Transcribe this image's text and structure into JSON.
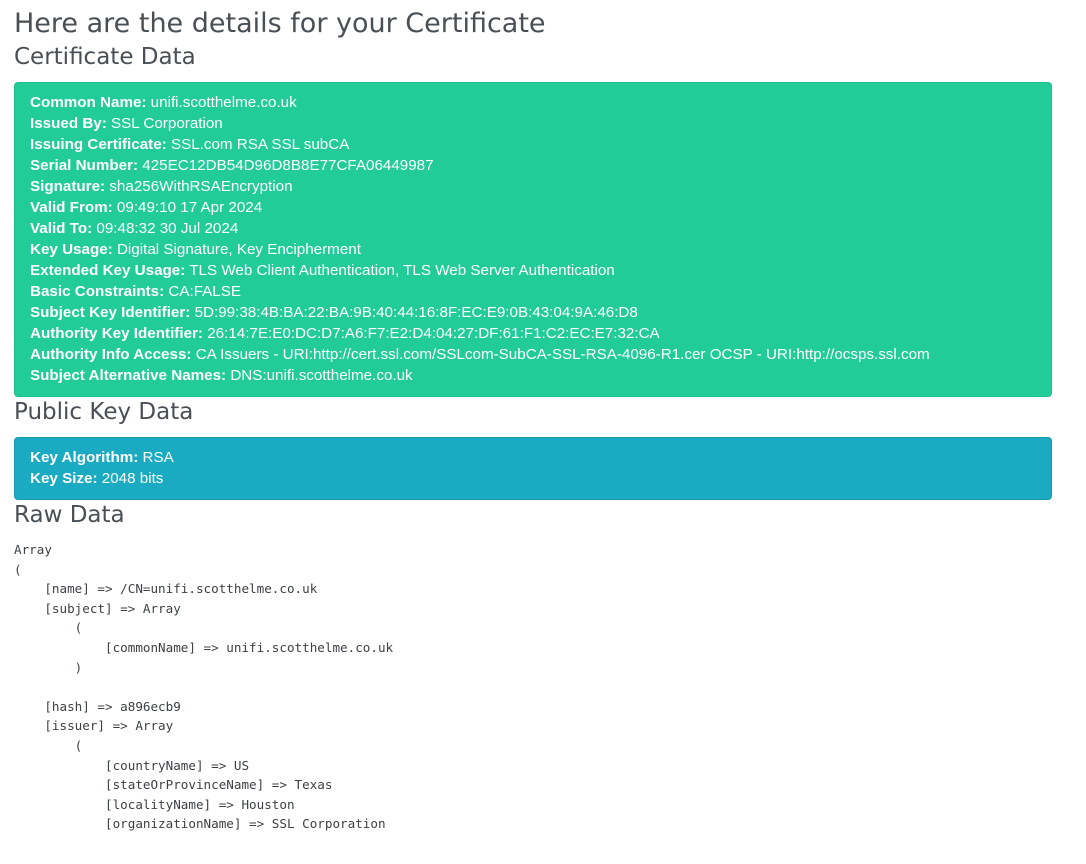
{
  "page": {
    "title": "Here are the details for your Certificate"
  },
  "certificate": {
    "heading": "Certificate Data",
    "fields": [
      {
        "label": "Common Name:",
        "value": " unifi.scotthelme.co.uk"
      },
      {
        "label": "Issued By:",
        "value": " SSL Corporation"
      },
      {
        "label": "Issuing Certificate:",
        "value": " SSL.com RSA SSL subCA"
      },
      {
        "label": "Serial Number:",
        "value": " 425EC12DB54D96D8B8E77CFA06449987"
      },
      {
        "label": "Signature:",
        "value": " sha256WithRSAEncryption"
      },
      {
        "label": "Valid From:",
        "value": " 09:49:10 17 Apr 2024"
      },
      {
        "label": "Valid To:",
        "value": " 09:48:32 30 Jul 2024"
      },
      {
        "label": "Key Usage:",
        "value": " Digital Signature, Key Encipherment"
      },
      {
        "label": "Extended Key Usage:",
        "value": " TLS Web Client Authentication, TLS Web Server Authentication"
      },
      {
        "label": "Basic Constraints:",
        "value": " CA:FALSE"
      },
      {
        "label": "Subject Key Identifier:",
        "value": " 5D:99:38:4B:BA:22:BA:9B:40:44:16:8F:EC:E9:0B:43:04:9A:46:D8"
      },
      {
        "label": "Authority Key Identifier:",
        "value": " 26:14:7E:E0:DC:D7:A6:F7:E2:D4:04:27:DF:61:F1:C2:EC:E7:32:CA"
      },
      {
        "label": "Authority Info Access:",
        "value": " CA Issuers - URI:http://cert.ssl.com/SSLcom-SubCA-SSL-RSA-4096-R1.cer OCSP - URI:http://ocsps.ssl.com"
      },
      {
        "label": "Subject Alternative Names:",
        "value": " DNS:unifi.scotthelme.co.uk"
      }
    ]
  },
  "public_key": {
    "heading": "Public Key Data",
    "fields": [
      {
        "label": "Key Algorithm:",
        "value": " RSA"
      },
      {
        "label": "Key Size:",
        "value": " 2048 bits"
      }
    ]
  },
  "raw": {
    "heading": "Raw Data",
    "text": "Array\n(\n    [name] => /CN=unifi.scotthelme.co.uk\n    [subject] => Array\n        (\n            [commonName] => unifi.scotthelme.co.uk\n        )\n\n    [hash] => a896ecb9\n    [issuer] => Array\n        (\n            [countryName] => US\n            [stateOrProvinceName] => Texas\n            [localityName] => Houston\n            [organizationName] => SSL Corporation"
  },
  "colors": {
    "certificate_panel": "#22cc98",
    "public_key_panel": "#1aaac1"
  }
}
